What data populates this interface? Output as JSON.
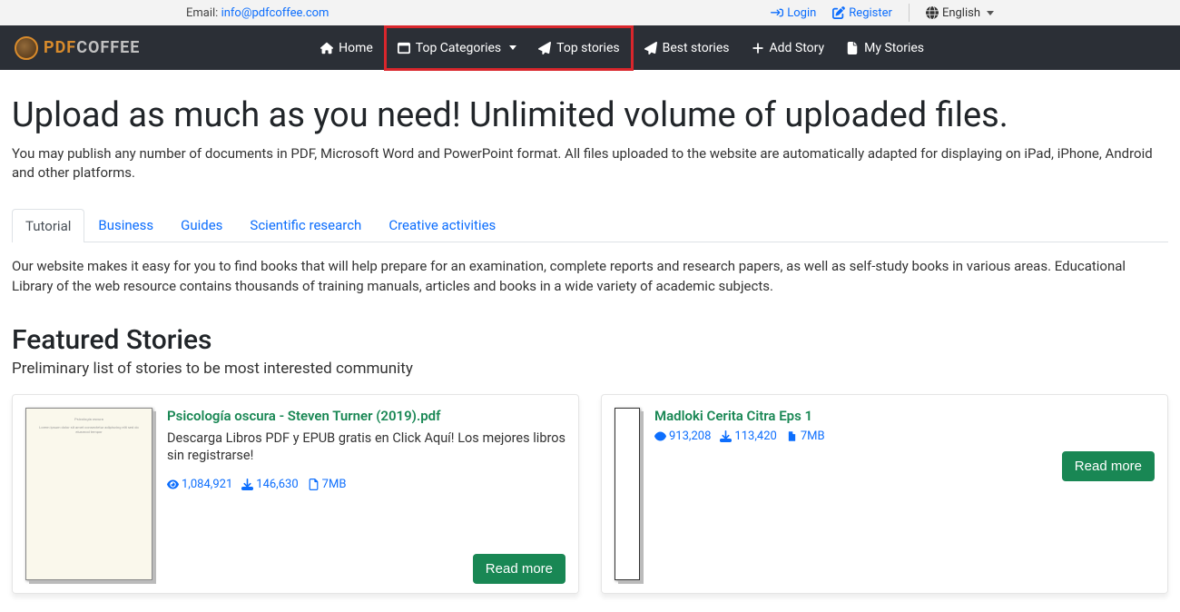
{
  "topstrip": {
    "email_label": "Email: ",
    "email": "info@pdfcoffee.com",
    "login": "Login",
    "register": "Register",
    "language": "English"
  },
  "brand": {
    "pdf": "PDF",
    "coffee": "COFFEE"
  },
  "nav": {
    "home": "Home",
    "top_categories": "Top Categories",
    "top_stories": "Top stories",
    "best_stories": "Best stories",
    "add_story": "Add Story",
    "my_stories": "My Stories"
  },
  "hero": {
    "title": "Upload as much as you need! Unlimited volume of uploaded files.",
    "subtitle": "You may publish any number of documents in PDF, Microsoft Word and PowerPoint format. All files uploaded to the website are automatically adapted for displaying on iPad, iPhone, Android and other platforms."
  },
  "tabs": {
    "items": [
      {
        "label": "Tutorial"
      },
      {
        "label": "Business"
      },
      {
        "label": "Guides"
      },
      {
        "label": "Scientific research"
      },
      {
        "label": "Creative activities"
      }
    ],
    "description": "Our website makes it easy for you to find books that will help prepare for an examination, complete reports and research papers, as well as self-study books in various areas. Educational Library of the web resource contains thousands of training manuals, articles and books in a wide variety of academic subjects."
  },
  "featured": {
    "title": "Featured Stories",
    "subtitle": "Preliminary list of stories to be most interested community",
    "cards": [
      {
        "title": "Psicología oscura - Steven Turner (2019).pdf",
        "desc": "Descarga Libros PDF y EPUB gratis en Click Aquí! Los mejores libros sin registrarse!",
        "views": "1,084,921",
        "downloads": "146,630",
        "size": "7MB",
        "button": "Read more"
      },
      {
        "title": "Madloki Cerita Citra Eps 1",
        "desc": "",
        "views": "913,208",
        "downloads": "113,420",
        "size": "7MB",
        "button": "Read more"
      }
    ]
  }
}
